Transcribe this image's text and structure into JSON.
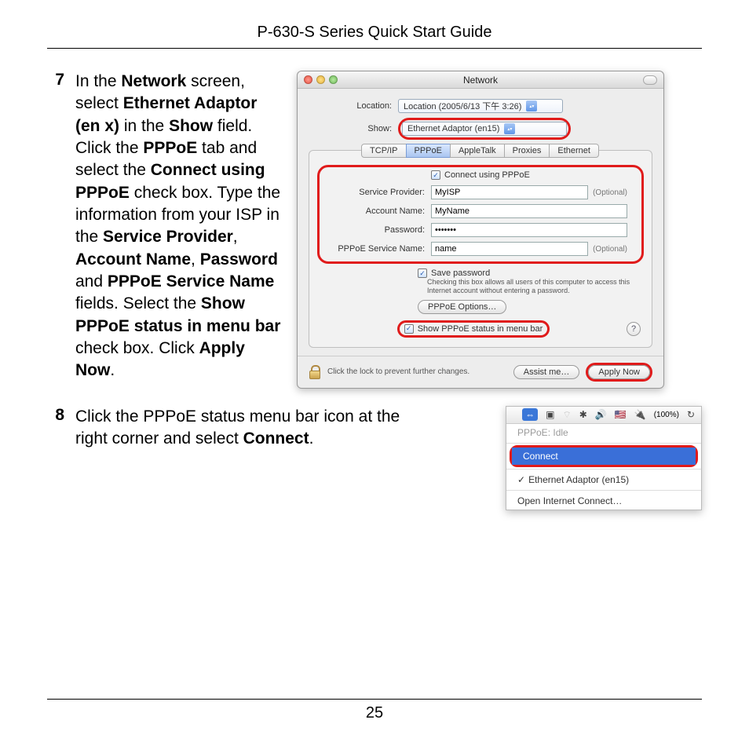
{
  "page": {
    "header_title": "P-630-S Series Quick Start Guide",
    "page_number": "25"
  },
  "step7": {
    "num": "7",
    "t1": "In the ",
    "b1": "Network",
    "t2": " screen, select ",
    "b2": "Ethernet Adaptor (en x)",
    "t3": " in the ",
    "b3": "Show",
    "t4": " field. Click the ",
    "b4": "PPPoE",
    "t5": " tab and select the ",
    "b5": "Connect using PPPoE",
    "t6": " check box. Type the information from your ISP in the ",
    "b6": "Service Provider",
    "t7": ", ",
    "b7": "Account Name",
    "t8": ", ",
    "b8": "Password",
    "t9": " and ",
    "b9": "PPPoE Service Name",
    "t10": " fields. Select the ",
    "b10": "Show PPPoE status in menu bar",
    "t11": " check box. Click ",
    "b11": "Apply Now",
    "t12": "."
  },
  "step8": {
    "num": "8",
    "t1": "Click the PPPoE status menu bar icon at the right corner and select ",
    "b1": "Connect",
    "t2": "."
  },
  "win": {
    "title": "Network",
    "location_label": "Location:",
    "location_value": "Location (2005/6/13 下午 3:26)",
    "show_label": "Show:",
    "show_value": "Ethernet Adaptor (en15)",
    "tabs": {
      "t1": "TCP/IP",
      "t2": "PPPoE",
      "t3": "AppleTalk",
      "t4": "Proxies",
      "t5": "Ethernet"
    },
    "connect_label": "Connect using PPPoE",
    "sp_label": "Service Provider:",
    "sp_value": "MyISP",
    "optional": "(Optional)",
    "an_label": "Account Name:",
    "an_value": "MyName",
    "pw_label": "Password:",
    "pw_value": "•••••••",
    "sn_label": "PPPoE Service Name:",
    "sn_value": "name",
    "save_label": "Save password",
    "save_note": "Checking this box allows all users of this computer to access this Internet account without entering a password.",
    "options_btn": "PPPoE Options…",
    "showstatus_label": "Show PPPoE status in menu bar",
    "help": "?",
    "lock_text": "Click the lock to prevent further changes.",
    "assist_btn": "Assist me…",
    "apply_btn": "Apply Now"
  },
  "menu": {
    "battery": "(100%)",
    "status": "PPPoE: Idle",
    "connect": "Connect",
    "adaptor": "Ethernet Adaptor (en15)",
    "open": "Open Internet Connect…"
  }
}
